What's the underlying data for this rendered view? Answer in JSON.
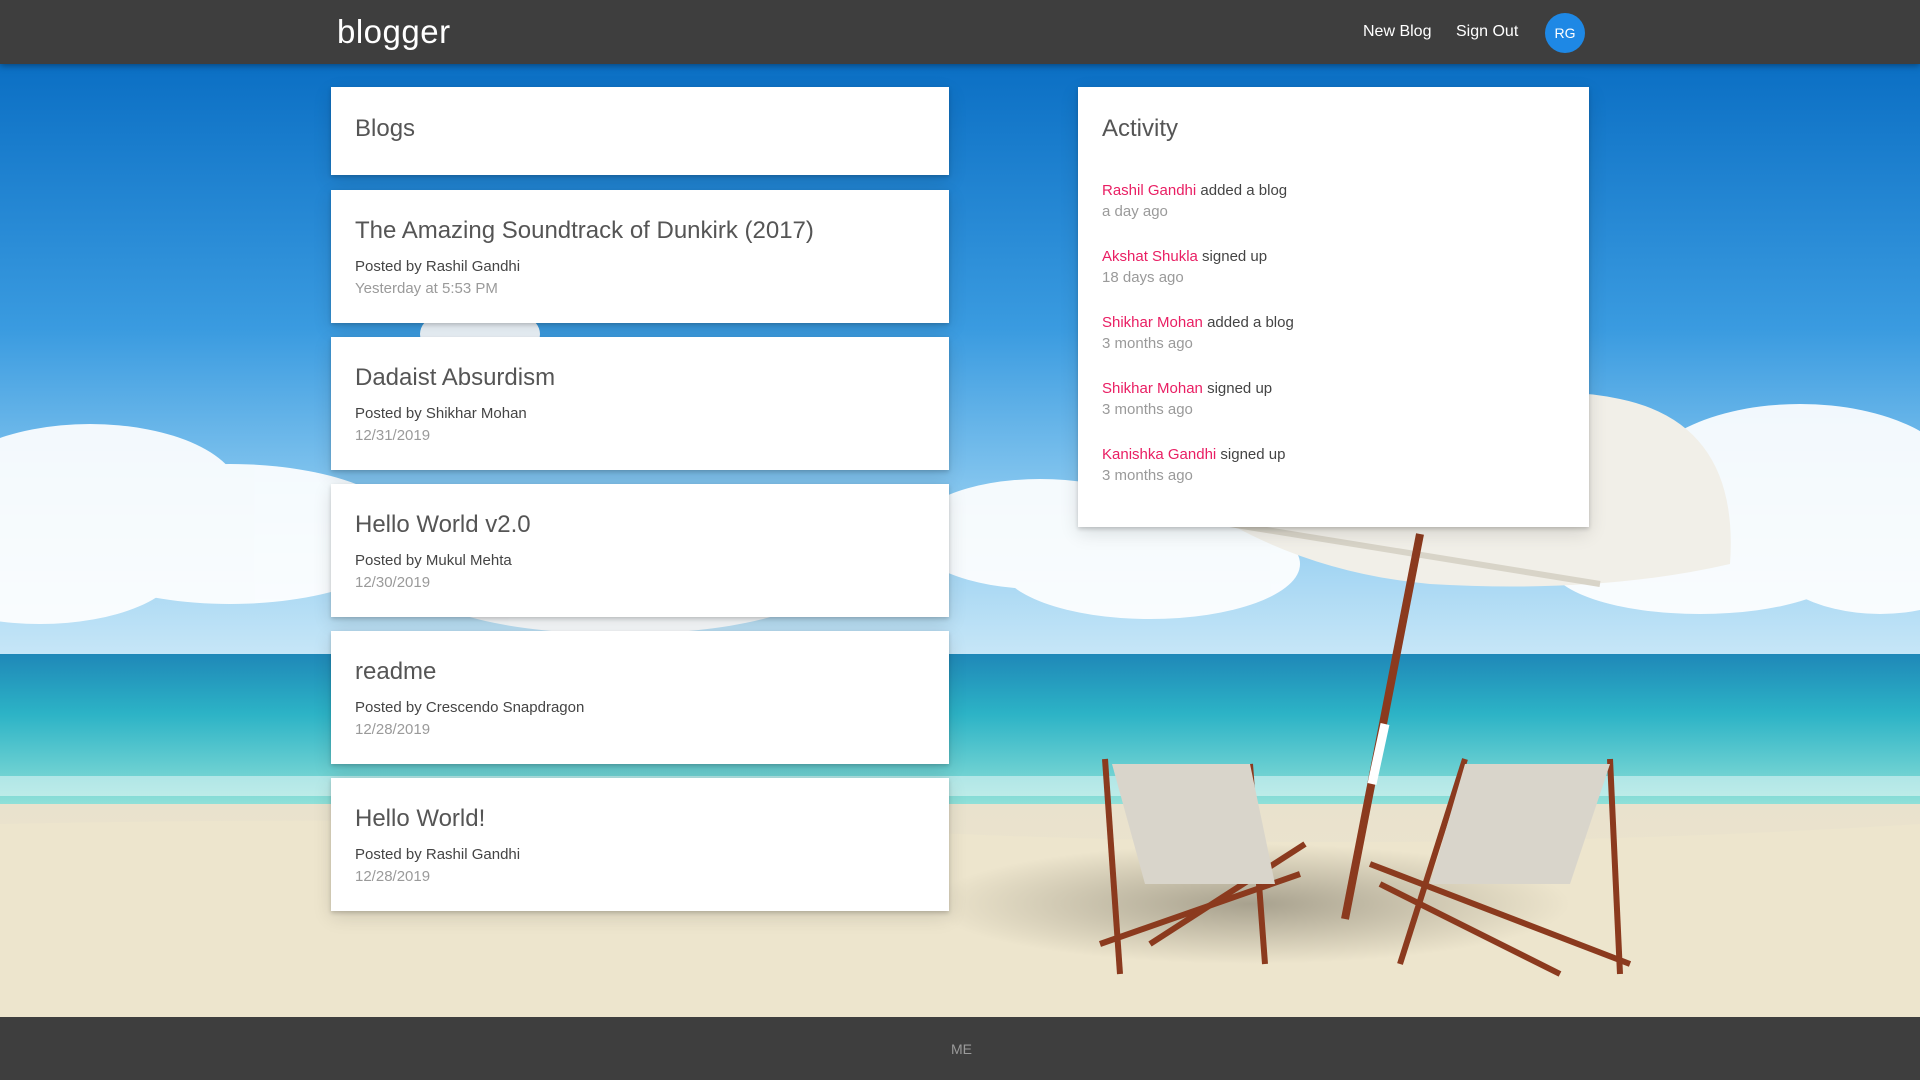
{
  "header": {
    "brand": "blogger",
    "new_blog_label": "New Blog",
    "sign_out_label": "Sign Out",
    "avatar_initials": "RG"
  },
  "blogs_panel": {
    "title": "Blogs",
    "posts": [
      {
        "title": "The Amazing Soundtrack of Dunkirk (2017)",
        "author": "Posted by Rashil Gandhi",
        "date": "Yesterday at 5:53 PM"
      },
      {
        "title": "Dadaist Absurdism",
        "author": "Posted by Shikhar Mohan",
        "date": "12/31/2019"
      },
      {
        "title": "Hello World v2.0",
        "author": "Posted by Mukul Mehta",
        "date": "12/30/2019"
      },
      {
        "title": "readme",
        "author": "Posted by Crescendo Snapdragon",
        "date": "12/28/2019"
      },
      {
        "title": "Hello World!",
        "author": "Posted by Rashil Gandhi",
        "date": "12/28/2019"
      }
    ]
  },
  "activity_panel": {
    "title": "Activity",
    "items": [
      {
        "user": "Rashil Gandhi",
        "action": " added a blog",
        "time": "a day ago"
      },
      {
        "user": "Akshat Shukla",
        "action": " signed up",
        "time": "18 days ago"
      },
      {
        "user": "Shikhar Mohan",
        "action": " added a blog",
        "time": "3 months ago"
      },
      {
        "user": "Shikhar Mohan",
        "action": " signed up",
        "time": "3 months ago"
      },
      {
        "user": "Kanishka Gandhi",
        "action": " signed up",
        "time": "3 months ago"
      }
    ]
  },
  "footer": {
    "text": "ME"
  },
  "colors": {
    "navbar": "#3e3e3e",
    "avatar": "#1e88e5",
    "activity_user": "#e91e63"
  }
}
